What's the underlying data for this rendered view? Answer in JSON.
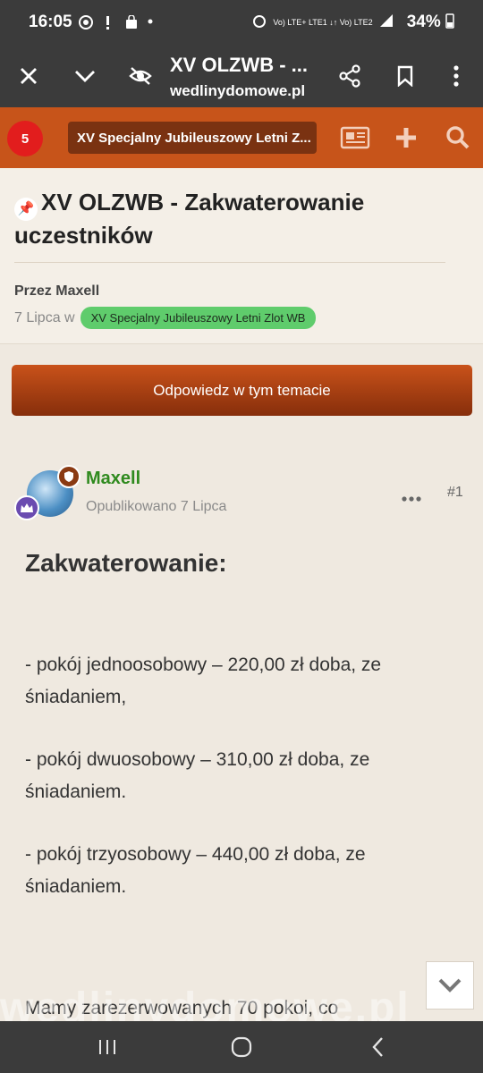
{
  "status": {
    "time": "16:05",
    "network_labels": "Vo) LTE+ LTE1 ↓↑  Vo) LTE2",
    "battery": "34%"
  },
  "browser": {
    "title": "XV OLZWB - ...",
    "url": "wedlinydomowe.pl"
  },
  "site_header": {
    "notification_count": "5",
    "breadcrumb": "XV Specjalny Jubileuszowy Letni Z..."
  },
  "topic": {
    "title": "XV OLZWB - Zakwaterowanie uczestników",
    "byline": "Przez Maxell",
    "date": "7 Lipca w",
    "forum_tag": "XV Specjalny Jubileuszowy Letni Zlot WB"
  },
  "reply_button": {
    "label": "Odpowiedz w tym temacie"
  },
  "post": {
    "author": "Maxell",
    "published": "Opublikowano 7 Lipca",
    "number": "#1",
    "heading": "Zakwaterowanie:",
    "paragraphs": [
      "- pokój jednoosobowy – 220,00 zł doba, ze śniadaniem,",
      "- pokój dwuosobowy – 310,00 zł doba, ze śniadaniem.",
      "- pokój trzyosobowy – 440,00 zł doba, ze śniadaniem.",
      "Mamy zarezerwowanych 70 pokoi, co"
    ]
  },
  "watermark": "wedlinydomowe.pl",
  "colors": {
    "header_orange": "#c7541a",
    "breadcrumb_brown": "#7a3211",
    "tag_green": "#5fcc6c",
    "author_green": "#2f8a1e",
    "notification_red": "#e21d1d"
  }
}
